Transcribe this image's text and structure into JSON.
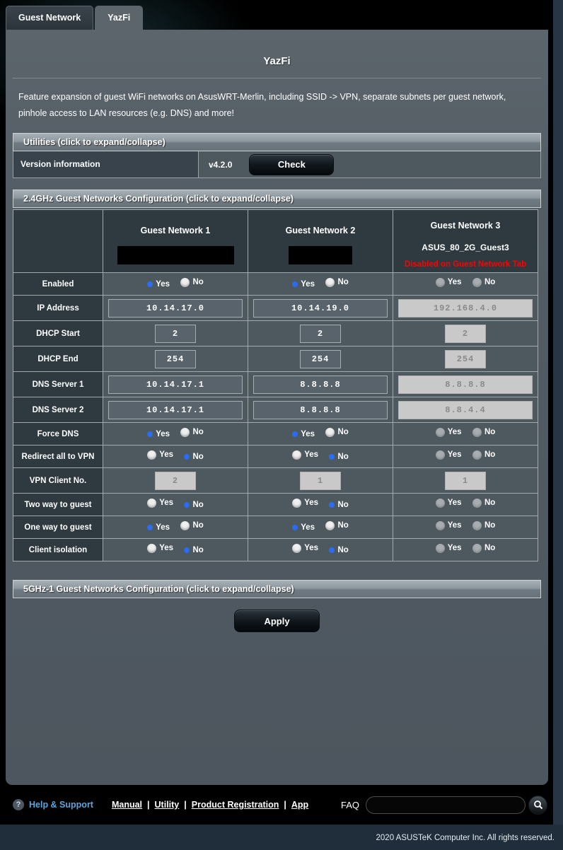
{
  "tabs": {
    "guest_network": "Guest Network",
    "yazfi": "YazFi"
  },
  "header": {
    "title": "YazFi",
    "description": "Feature expansion of guest WiFi networks on AsusWRT-Merlin, including SSID -> VPN, separate subnets per guest network, pinhole access to LAN resources (e.g. DNS) and more!"
  },
  "utilities": {
    "header": "Utilities (click to expand/collapse)",
    "version_label": "Version information",
    "version_value": "v4.2.0",
    "check_button": "Check"
  },
  "radio_labels": {
    "yes": "Yes",
    "no": "No"
  },
  "config_24ghz": {
    "header": "2.4GHz Guest Networks Configuration (click to expand/collapse)",
    "columns": [
      {
        "title": "Guest Network 1"
      },
      {
        "title": "Guest Network 2"
      },
      {
        "title": "Guest Network 3",
        "ssid": "ASUS_80_2G_Guest3",
        "note": "Disabled on Guest Network Tab"
      }
    ],
    "rows": {
      "enabled": {
        "label": "Enabled",
        "values": [
          "yes",
          "yes",
          "disabled"
        ]
      },
      "ip_address": {
        "label": "IP Address",
        "values": [
          "10.14.17.0",
          "10.14.19.0",
          "192.168.4.0"
        ]
      },
      "dhcp_start": {
        "label": "DHCP Start",
        "values": [
          "2",
          "2",
          "2"
        ]
      },
      "dhcp_end": {
        "label": "DHCP End",
        "values": [
          "254",
          "254",
          "254"
        ]
      },
      "dns_server_1": {
        "label": "DNS Server 1",
        "values": [
          "10.14.17.1",
          "8.8.8.8",
          "8.8.8.8"
        ]
      },
      "dns_server_2": {
        "label": "DNS Server 2",
        "values": [
          "10.14.17.1",
          "8.8.8.8",
          "8.8.4.4"
        ]
      },
      "force_dns": {
        "label": "Force DNS",
        "values": [
          "yes",
          "yes",
          "disabled"
        ]
      },
      "redirect_vpn": {
        "label": "Redirect all to VPN",
        "values": [
          "no",
          "no",
          "disabled"
        ]
      },
      "vpn_client": {
        "label": "VPN Client No.",
        "values": [
          "2",
          "1",
          "1"
        ]
      },
      "two_way": {
        "label": "Two way to guest",
        "values": [
          "no",
          "no",
          "disabled"
        ]
      },
      "one_way": {
        "label": "One way to guest",
        "values": [
          "yes",
          "yes",
          "disabled"
        ]
      },
      "client_isolation": {
        "label": "Client isolation",
        "values": [
          "no",
          "no",
          "disabled"
        ]
      }
    }
  },
  "config_5ghz": {
    "header": "5GHz-1 Guest Networks Configuration (click to expand/collapse)"
  },
  "apply_button": "Apply",
  "footer": {
    "help_icon": "?",
    "help_label": "Help & Support",
    "links": [
      "Manual",
      "Utility",
      "Product Registration",
      "App"
    ],
    "separator": "|",
    "faq_label": "FAQ",
    "copyright": "2020 ASUSTeK Computer Inc. All rights reserved."
  }
}
